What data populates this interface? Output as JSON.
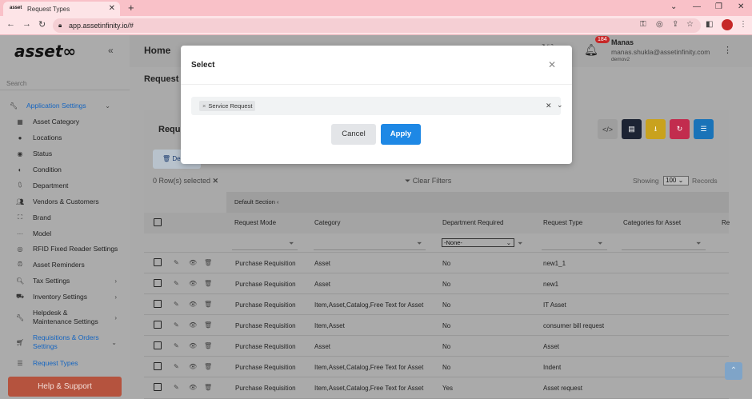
{
  "browser": {
    "tab_title": "Request Types",
    "url": "app.assetinfinity.io/#",
    "colors": {
      "tabbar": "#f9c1c8",
      "addressbar": "#fde4e7"
    }
  },
  "sidebar": {
    "logo": "asset∞",
    "search_label": "Search",
    "items": [
      {
        "label": "Application Settings",
        "icon": "wrench-icon",
        "expanded": true
      },
      {
        "label": "Asset Category",
        "icon": "grid-icon"
      },
      {
        "label": "Locations",
        "icon": "pin-icon"
      },
      {
        "label": "Status",
        "icon": "status-icon"
      },
      {
        "label": "Condition",
        "icon": "condition-icon"
      },
      {
        "label": "Department",
        "icon": "org-icon"
      },
      {
        "label": "Vendors & Customers",
        "icon": "users-icon"
      },
      {
        "label": "Brand",
        "icon": "brand-icon"
      },
      {
        "label": "Model",
        "icon": "dots-icon"
      },
      {
        "label": "RFID Fixed Reader Settings",
        "icon": "rfid-icon"
      },
      {
        "label": "Asset Reminders",
        "icon": "reminder-icon"
      },
      {
        "label": "Tax Settings",
        "icon": "tax-icon"
      },
      {
        "label": "Inventory Settings",
        "icon": "truck-icon"
      },
      {
        "label": "Helpdesk &",
        "label2": "Maintenance Settings",
        "icon": "wrench-icon"
      },
      {
        "label": "Requisitions & Orders",
        "label2": "Settings",
        "icon": "cart-icon"
      },
      {
        "label": "Request Types",
        "icon": "list-icon"
      }
    ],
    "help_label": "Help & Support"
  },
  "header": {
    "home": "Home",
    "notification_count": "184",
    "user_name": "Manas",
    "user_email": "manas.shukla@assetinfinity.com",
    "user_role": "demov2"
  },
  "page": {
    "title": "Request",
    "card_title": "Requ",
    "delete_label": "De",
    "rows_selected": "0 Row(s) selected",
    "clear_filters": "Clear Filters",
    "showing": "Showing",
    "page_size": "100",
    "records": "Records",
    "section_label": "Default Section",
    "toolbar_colors": [
      "#9e9e9e",
      "#1c2333",
      "#c9a21e",
      "#c22c4e",
      "#1a73b8"
    ]
  },
  "table": {
    "columns": [
      "Request Mode",
      "Category",
      "Department Required",
      "Request Type",
      "Categories for Asset",
      "Re"
    ],
    "dept_filter_value": "-None-",
    "rows": [
      {
        "mode": "Purchase Requisition",
        "category": "Asset",
        "dept": "No",
        "type": "new1_1"
      },
      {
        "mode": "Purchase Requisition",
        "category": "Asset",
        "dept": "No",
        "type": "new1"
      },
      {
        "mode": "Purchase Requisition",
        "category": "Item,Asset,Catalog,Free Text for Asset",
        "dept": "No",
        "type": "IT Asset"
      },
      {
        "mode": "Purchase Requisition",
        "category": "Item,Asset",
        "dept": "No",
        "type": "consumer bill request"
      },
      {
        "mode": "Purchase Requisition",
        "category": "Asset",
        "dept": "No",
        "type": "Asset"
      },
      {
        "mode": "Purchase Requisition",
        "category": "Item,Asset,Catalog,Free Text for Asset",
        "dept": "No",
        "type": "Indent"
      },
      {
        "mode": "Purchase Requisition",
        "category": "Item,Asset,Catalog,Free Text for Asset",
        "dept": "Yes",
        "type": "Asset request"
      }
    ]
  },
  "modal": {
    "title": "Select",
    "chip": "Service Request",
    "cancel": "Cancel",
    "apply": "Apply",
    "colors": {
      "apply": "#1e88e5"
    }
  }
}
